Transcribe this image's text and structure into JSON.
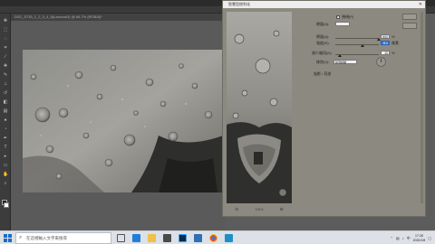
{
  "photoshop": {
    "document_tab": "DSC_5735_1_2_3_4_5(Lanczos3) @ 66.7% (RGB/8)*",
    "tools": [
      "move-icon",
      "marquee-icon",
      "lasso-icon",
      "crop-icon",
      "eyedropper-icon",
      "heal-icon",
      "brush-icon",
      "stamp-icon",
      "history-brush-icon",
      "eraser-icon",
      "gradient-icon",
      "blur-icon",
      "dodge-icon",
      "pen-icon",
      "type-icon",
      "path-select-icon",
      "shape-icon",
      "hand-icon",
      "zoom-icon"
    ]
  },
  "dialog": {
    "title": "智慧型銳利化",
    "close": "✕",
    "preview_checkbox_label": "預視(P)",
    "preview_checked": true,
    "amount_label": "總量(A):",
    "amount_value": "500",
    "amount_unit": "%",
    "amount_fraction": 1.0,
    "radius_label": "強度(R):",
    "radius_value": "8.1",
    "radius_unit": "像素",
    "radius_fraction": 0.62,
    "noise_label": "減少雜訊(N):",
    "noise_value": "10",
    "noise_unit": "%",
    "noise_fraction": 0.1,
    "remove_label": "移除(V):",
    "remove_value": "鏡頭模糊",
    "shadows_highlights_label": "陰影 / 亮部",
    "zoom_out_icon": "zoom-out-icon",
    "zoom_in_icon": "zoom-in-icon",
    "zoom_level": "100%",
    "colors": {
      "dialog_bg": "#8c8a80",
      "active_field": "#3c7be0"
    }
  },
  "taskbar": {
    "search_placeholder": "在這裡輸入文字來搜尋",
    "time": "17:28",
    "date": "2020/1/8",
    "lang": "中",
    "apps": [
      "task-view-icon",
      "edge-icon",
      "explorer-icon",
      "store-icon",
      "photoshop-icon",
      "mail-icon",
      "chrome-icon",
      "photos-icon"
    ]
  }
}
